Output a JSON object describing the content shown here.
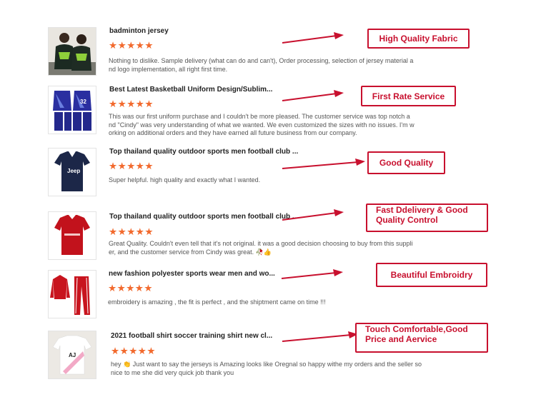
{
  "colors": {
    "accent": "#c8102e",
    "star": "#f26a2e"
  },
  "reviews": [
    {
      "title": "badminton jersey",
      "stars": "★★★★★",
      "rating": 5,
      "text": "Nothing to dislike. Sample delivery (what can do and can't), Order processing, selection of jersey material a nd logo implementation, all right first time.",
      "badge": "High Quality Fabric"
    },
    {
      "title": "Best Latest Basketball Uniform Design/Sublim...",
      "stars": "★★★★★",
      "rating": 5,
      "text": "This was our first uniform purchase and I couldn't be more pleased. The customer service was top notch a nd \"Cindy\" was very understanding of what we wanted. We even customized the sizes with no issues. I'm w orking on additional orders and they have earned all future business from our company.",
      "badge": "First Rate Service"
    },
    {
      "title": "Top thailand quality outdoor sports men football club ...",
      "stars": "★★★★★",
      "rating": 5,
      "text": "Super helpful. high quality and exactly what I wanted.",
      "badge": "Good Quality"
    },
    {
      "title": "Top thailand quality outdoor sports men football club ...",
      "stars": "★★★★★",
      "rating": 5,
      "text": "Great Quality. Couldn't even tell that it's not original. it was a good decision choosing to buy from this suppli er, and the customer service from Cindy was great.",
      "emoji": "🥀👍",
      "badge_line1": "Fast Ddelivery & Good",
      "badge_line2": "Quality Control"
    },
    {
      "title": "new fashion polyester sports wear men and wo...",
      "stars": "★★★★★",
      "rating": 5,
      "text": "embroidery is amazing , the fit is perfect , and the shiptment came on time !!!",
      "badge": "Beautiful Embroidry"
    },
    {
      "title": "2021 football shirt soccer training shirt new cl...",
      "stars": "★★★★★",
      "rating": 5,
      "text_pre": "hey",
      "emoji": "👏",
      "text": "Just want to say the jerseys is Amazing looks like Oregnal so happy withe my orders and the seller so nice to me she did very quick job thank you",
      "badge_line1": "Touch Comfortable,Good",
      "badge_line2": "Price and Aervice"
    }
  ]
}
